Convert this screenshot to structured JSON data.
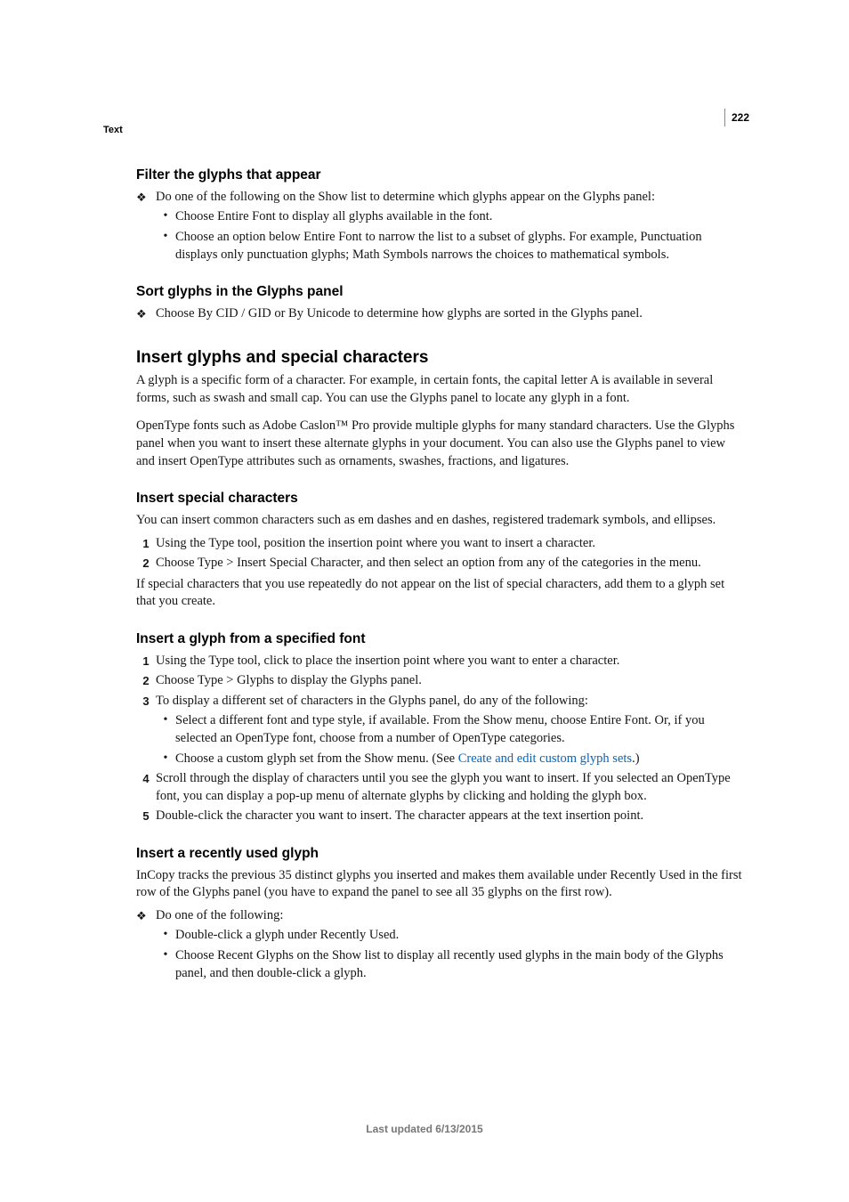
{
  "page_number": "222",
  "breadcrumb": "Text",
  "s1": {
    "heading": "Filter the glyphs that appear",
    "lead": "Do one of the following on the Show list to determine which glyphs appear on the Glyphs panel:",
    "b1": "Choose Entire Font to display all glyphs available in the font.",
    "b2": "Choose an option below Entire Font to narrow the list to a subset of glyphs. For example, Punctuation displays only punctuation glyphs; Math Symbols narrows the choices to mathematical symbols."
  },
  "s2": {
    "heading": "Sort glyphs in the Glyphs panel",
    "b1": "Choose By CID / GID or By Unicode to determine how glyphs are sorted in the Glyphs panel."
  },
  "s3": {
    "heading": "Insert glyphs and special characters",
    "p1": "A glyph is a specific form of a character. For example, in certain fonts, the capital letter A is available in several forms, such as swash and small cap. You can use the Glyphs panel to locate any glyph in a font.",
    "p2": "OpenType fonts such as Adobe Caslon™ Pro provide multiple glyphs for many standard characters. Use the Glyphs panel when you want to insert these alternate glyphs in your document. You can also use the Glyphs panel to view and insert OpenType attributes such as ornaments, swashes, fractions, and ligatures."
  },
  "s4": {
    "heading": "Insert special characters",
    "p1": "You can insert common characters such as em dashes and en dashes, registered trademark symbols, and ellipses.",
    "n1": "Using the Type tool, position the insertion point where you want to insert a character.",
    "n2": "Choose Type > Insert Special Character, and then select an option from any of the categories in the menu.",
    "p2": "If special characters that you use repeatedly do not appear on the list of special characters, add them to a glyph set that you create."
  },
  "s5": {
    "heading": "Insert a glyph from a specified font",
    "n1": "Using the Type tool, click to place the insertion point where you want to enter a character.",
    "n2": "Choose Type > Glyphs to display the Glyphs panel.",
    "n3": "To display a different set of characters in the Glyphs panel, do any of the following:",
    "b1": "Select a different font and type style, if available. From the Show menu, choose Entire Font. Or, if you selected an OpenType font, choose from a number of OpenType categories.",
    "b2a": "Choose a custom glyph set from the Show menu. (See ",
    "b2link": "Create and edit custom glyph sets",
    "b2b": ".)",
    "n4": "Scroll through the display of characters until you see the glyph you want to insert. If you selected an OpenType font, you can display a pop-up menu of alternate glyphs by clicking and holding the glyph box.",
    "n5": "Double-click the character you want to insert. The character appears at the text insertion point."
  },
  "s6": {
    "heading": "Insert a recently used glyph",
    "p1": "InCopy tracks the previous 35 distinct glyphs you inserted and makes them available under Recently Used in the first row of the Glyphs panel (you have to expand the panel to see all 35 glyphs on the first row).",
    "lead": "Do one of the following:",
    "b1": "Double-click a glyph under Recently Used.",
    "b2": "Choose Recent Glyphs on the Show list to display all recently used glyphs in the main body of the Glyphs panel, and then double-click a glyph."
  },
  "footer": "Last updated 6/13/2015"
}
